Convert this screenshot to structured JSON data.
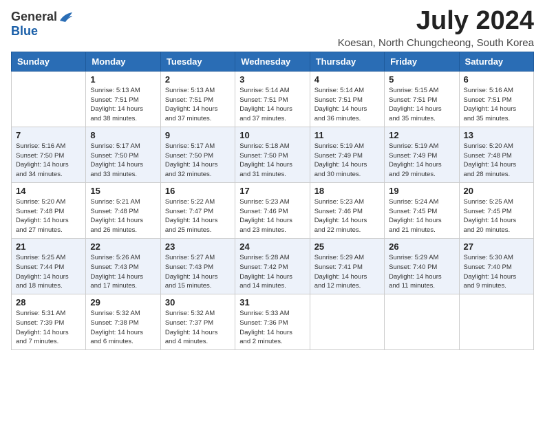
{
  "header": {
    "logo": {
      "general": "General",
      "blue": "Blue"
    },
    "title": "July 2024",
    "location": "Koesan, North Chungcheong, South Korea"
  },
  "weekdays": [
    "Sunday",
    "Monday",
    "Tuesday",
    "Wednesday",
    "Thursday",
    "Friday",
    "Saturday"
  ],
  "weeks": [
    [
      {
        "day": "",
        "info": ""
      },
      {
        "day": "1",
        "info": "Sunrise: 5:13 AM\nSunset: 7:51 PM\nDaylight: 14 hours\nand 38 minutes."
      },
      {
        "day": "2",
        "info": "Sunrise: 5:13 AM\nSunset: 7:51 PM\nDaylight: 14 hours\nand 37 minutes."
      },
      {
        "day": "3",
        "info": "Sunrise: 5:14 AM\nSunset: 7:51 PM\nDaylight: 14 hours\nand 37 minutes."
      },
      {
        "day": "4",
        "info": "Sunrise: 5:14 AM\nSunset: 7:51 PM\nDaylight: 14 hours\nand 36 minutes."
      },
      {
        "day": "5",
        "info": "Sunrise: 5:15 AM\nSunset: 7:51 PM\nDaylight: 14 hours\nand 35 minutes."
      },
      {
        "day": "6",
        "info": "Sunrise: 5:16 AM\nSunset: 7:51 PM\nDaylight: 14 hours\nand 35 minutes."
      }
    ],
    [
      {
        "day": "7",
        "info": "Sunrise: 5:16 AM\nSunset: 7:50 PM\nDaylight: 14 hours\nand 34 minutes."
      },
      {
        "day": "8",
        "info": "Sunrise: 5:17 AM\nSunset: 7:50 PM\nDaylight: 14 hours\nand 33 minutes."
      },
      {
        "day": "9",
        "info": "Sunrise: 5:17 AM\nSunset: 7:50 PM\nDaylight: 14 hours\nand 32 minutes."
      },
      {
        "day": "10",
        "info": "Sunrise: 5:18 AM\nSunset: 7:50 PM\nDaylight: 14 hours\nand 31 minutes."
      },
      {
        "day": "11",
        "info": "Sunrise: 5:19 AM\nSunset: 7:49 PM\nDaylight: 14 hours\nand 30 minutes."
      },
      {
        "day": "12",
        "info": "Sunrise: 5:19 AM\nSunset: 7:49 PM\nDaylight: 14 hours\nand 29 minutes."
      },
      {
        "day": "13",
        "info": "Sunrise: 5:20 AM\nSunset: 7:48 PM\nDaylight: 14 hours\nand 28 minutes."
      }
    ],
    [
      {
        "day": "14",
        "info": "Sunrise: 5:20 AM\nSunset: 7:48 PM\nDaylight: 14 hours\nand 27 minutes."
      },
      {
        "day": "15",
        "info": "Sunrise: 5:21 AM\nSunset: 7:48 PM\nDaylight: 14 hours\nand 26 minutes."
      },
      {
        "day": "16",
        "info": "Sunrise: 5:22 AM\nSunset: 7:47 PM\nDaylight: 14 hours\nand 25 minutes."
      },
      {
        "day": "17",
        "info": "Sunrise: 5:23 AM\nSunset: 7:46 PM\nDaylight: 14 hours\nand 23 minutes."
      },
      {
        "day": "18",
        "info": "Sunrise: 5:23 AM\nSunset: 7:46 PM\nDaylight: 14 hours\nand 22 minutes."
      },
      {
        "day": "19",
        "info": "Sunrise: 5:24 AM\nSunset: 7:45 PM\nDaylight: 14 hours\nand 21 minutes."
      },
      {
        "day": "20",
        "info": "Sunrise: 5:25 AM\nSunset: 7:45 PM\nDaylight: 14 hours\nand 20 minutes."
      }
    ],
    [
      {
        "day": "21",
        "info": "Sunrise: 5:25 AM\nSunset: 7:44 PM\nDaylight: 14 hours\nand 18 minutes."
      },
      {
        "day": "22",
        "info": "Sunrise: 5:26 AM\nSunset: 7:43 PM\nDaylight: 14 hours\nand 17 minutes."
      },
      {
        "day": "23",
        "info": "Sunrise: 5:27 AM\nSunset: 7:43 PM\nDaylight: 14 hours\nand 15 minutes."
      },
      {
        "day": "24",
        "info": "Sunrise: 5:28 AM\nSunset: 7:42 PM\nDaylight: 14 hours\nand 14 minutes."
      },
      {
        "day": "25",
        "info": "Sunrise: 5:29 AM\nSunset: 7:41 PM\nDaylight: 14 hours\nand 12 minutes."
      },
      {
        "day": "26",
        "info": "Sunrise: 5:29 AM\nSunset: 7:40 PM\nDaylight: 14 hours\nand 11 minutes."
      },
      {
        "day": "27",
        "info": "Sunrise: 5:30 AM\nSunset: 7:40 PM\nDaylight: 14 hours\nand 9 minutes."
      }
    ],
    [
      {
        "day": "28",
        "info": "Sunrise: 5:31 AM\nSunset: 7:39 PM\nDaylight: 14 hours\nand 7 minutes."
      },
      {
        "day": "29",
        "info": "Sunrise: 5:32 AM\nSunset: 7:38 PM\nDaylight: 14 hours\nand 6 minutes."
      },
      {
        "day": "30",
        "info": "Sunrise: 5:32 AM\nSunset: 7:37 PM\nDaylight: 14 hours\nand 4 minutes."
      },
      {
        "day": "31",
        "info": "Sunrise: 5:33 AM\nSunset: 7:36 PM\nDaylight: 14 hours\nand 2 minutes."
      },
      {
        "day": "",
        "info": ""
      },
      {
        "day": "",
        "info": ""
      },
      {
        "day": "",
        "info": ""
      }
    ]
  ]
}
